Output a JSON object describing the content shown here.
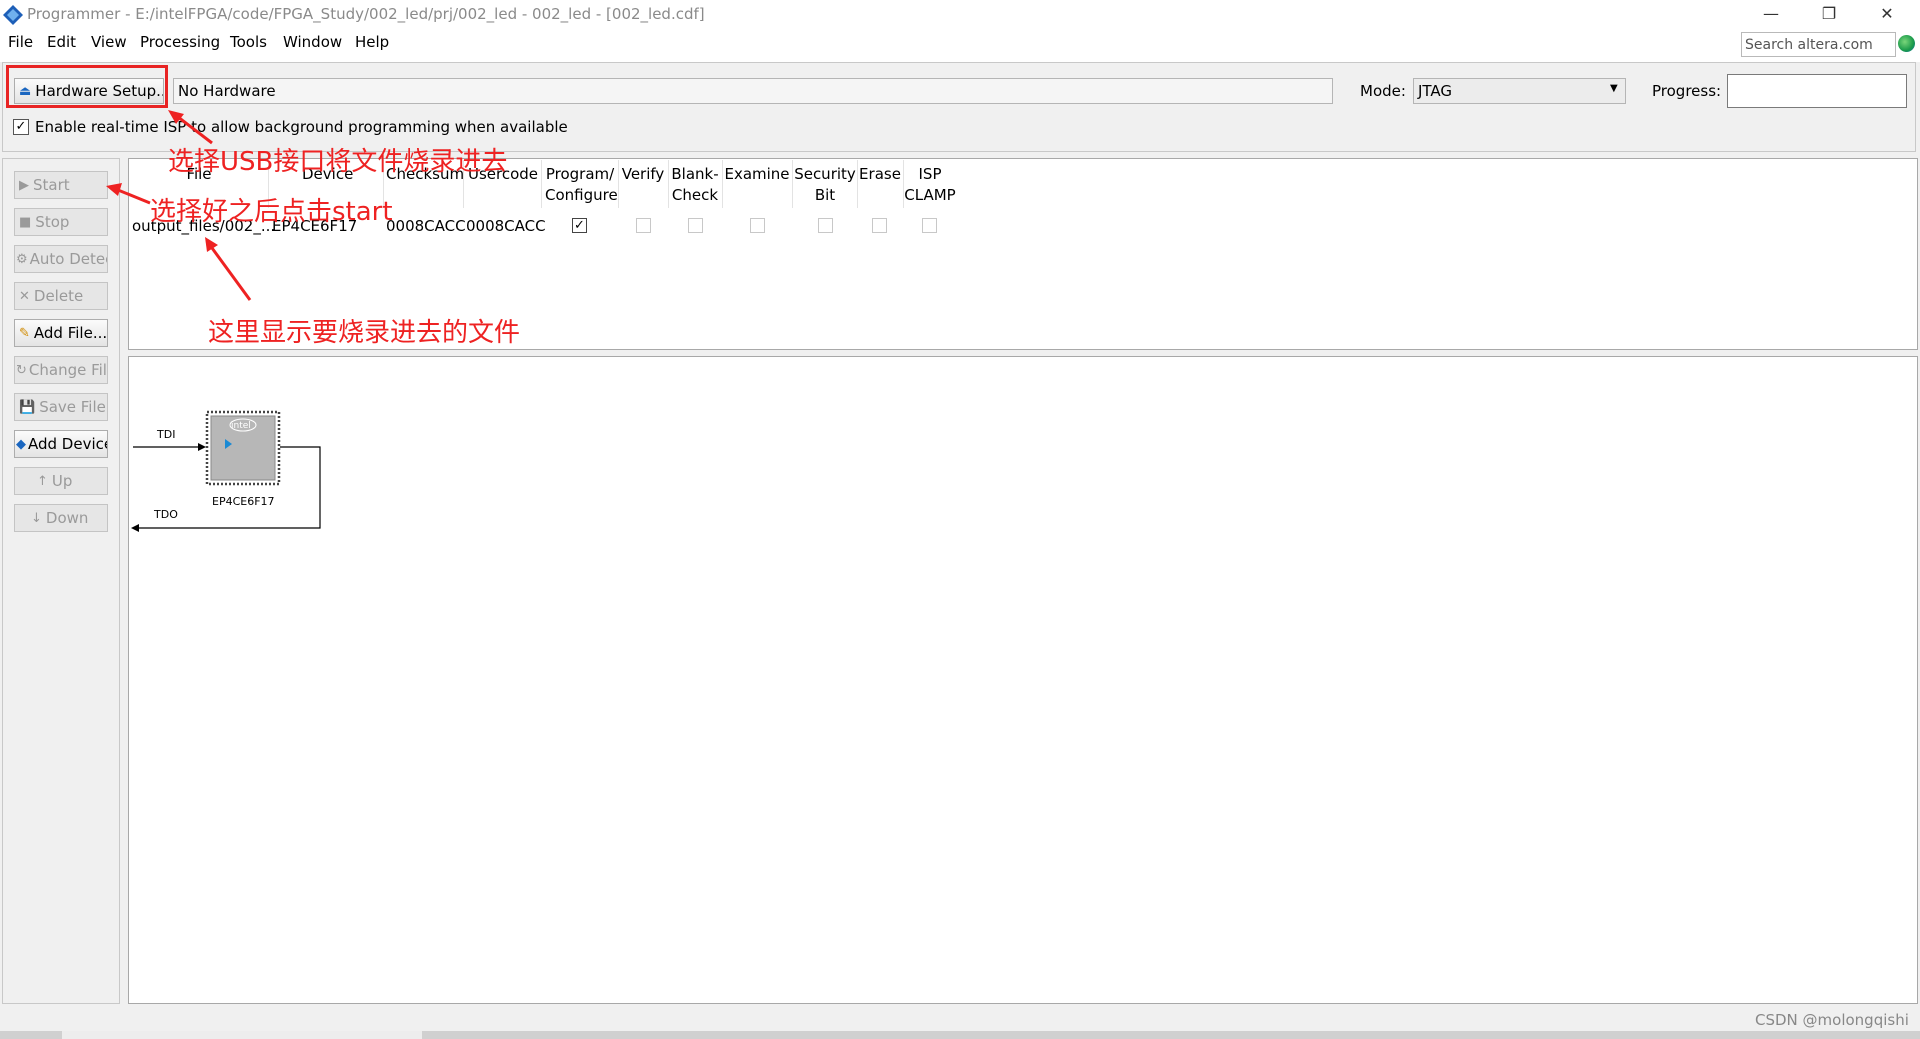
{
  "window": {
    "title": "Programmer - E:/intelFPGA/code/FPGA_Study/002_led/prj/002_led - 002_led - [002_led.cdf]",
    "minimize": "—",
    "restore": "❐",
    "close": "✕"
  },
  "menu": {
    "items": [
      "File",
      "Edit",
      "View",
      "Processing",
      "Tools",
      "Window",
      "Help"
    ],
    "search_placeholder": "Search altera.com"
  },
  "toolbar": {
    "hardware_setup": "Hardware Setup...",
    "hardware_value": "No Hardware",
    "mode_label": "Mode:",
    "mode_value": "JTAG",
    "progress_label": "Progress:",
    "isp_label": "Enable real-time ISP to allow background programming when available",
    "isp_checked": true
  },
  "side_buttons": [
    {
      "label": "Start",
      "enabled": false
    },
    {
      "label": "Stop",
      "enabled": false
    },
    {
      "label": "Auto Detect",
      "enabled": false
    },
    {
      "label": "Delete",
      "enabled": false
    },
    {
      "label": "Add File...",
      "enabled": true
    },
    {
      "label": "Change File",
      "enabled": false
    },
    {
      "label": "Save File",
      "enabled": false
    },
    {
      "label": "Add Device",
      "enabled": true
    },
    {
      "label": "Up",
      "enabled": false
    },
    {
      "label": "Down",
      "enabled": false
    }
  ],
  "table": {
    "columns": [
      "File",
      "Device",
      "Checksum",
      "Usercode",
      "Program/\nConfigure",
      "Verify",
      "Blank-\nCheck",
      "Examine",
      "Security\nBit",
      "Erase",
      "ISP\nCLAMP"
    ],
    "rows": [
      {
        "file": "output_files/002_...",
        "device": "EP4CE6F17",
        "checksum": "0008CACC",
        "usercode": "0008CACC",
        "program": true,
        "verify": false,
        "blank_check": false,
        "examine": false,
        "security_bit": false,
        "erase": false,
        "isp_clamp": false
      }
    ]
  },
  "chain": {
    "tdi": "TDI",
    "tdo": "TDO",
    "chip_brand": "intel",
    "chip_label": "EP4CE6F17"
  },
  "annotations": {
    "hardware": "选择USB接口将文件烧录进去",
    "start": "选择好之后点击start",
    "file": "这里显示要烧录进去的文件",
    "color": "#ee2222"
  },
  "watermark": "CSDN @molongqishi"
}
